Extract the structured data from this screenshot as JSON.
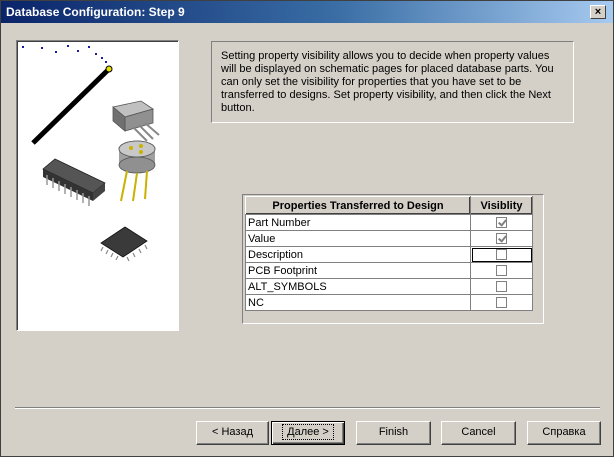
{
  "window": {
    "title": "Database Configuration: Step 9",
    "close_glyph": "×"
  },
  "info": {
    "text": "Setting property visibility allows you to decide when property values will be displayed on schematic pages for placed database parts. You can only set the visibility for properties that you have set to be transferred to designs. Set property visibility, and then click the Next button."
  },
  "grid": {
    "header_property": "Properties Transferred to Design",
    "header_visibility": "Visiblity",
    "rows": [
      {
        "name": "Part Number",
        "checked": true,
        "disabled": true
      },
      {
        "name": "Value",
        "checked": true,
        "disabled": true
      },
      {
        "name": "Description",
        "checked": false,
        "focused": true
      },
      {
        "name": "PCB Footprint",
        "checked": false
      },
      {
        "name": "ALT_SYMBOLS",
        "checked": false
      },
      {
        "name": "NC",
        "checked": false
      }
    ]
  },
  "buttons": {
    "back": "< Назад",
    "next": "Далее >",
    "finish": "Finish",
    "cancel": "Cancel",
    "help": "Справка"
  },
  "colors": {
    "titlebar_start": "#0a246a",
    "titlebar_end": "#a6caf0",
    "face": "#d4d0c8"
  },
  "icons": [
    "close-icon",
    "wizard-illustration",
    "checkbox-icon"
  ]
}
